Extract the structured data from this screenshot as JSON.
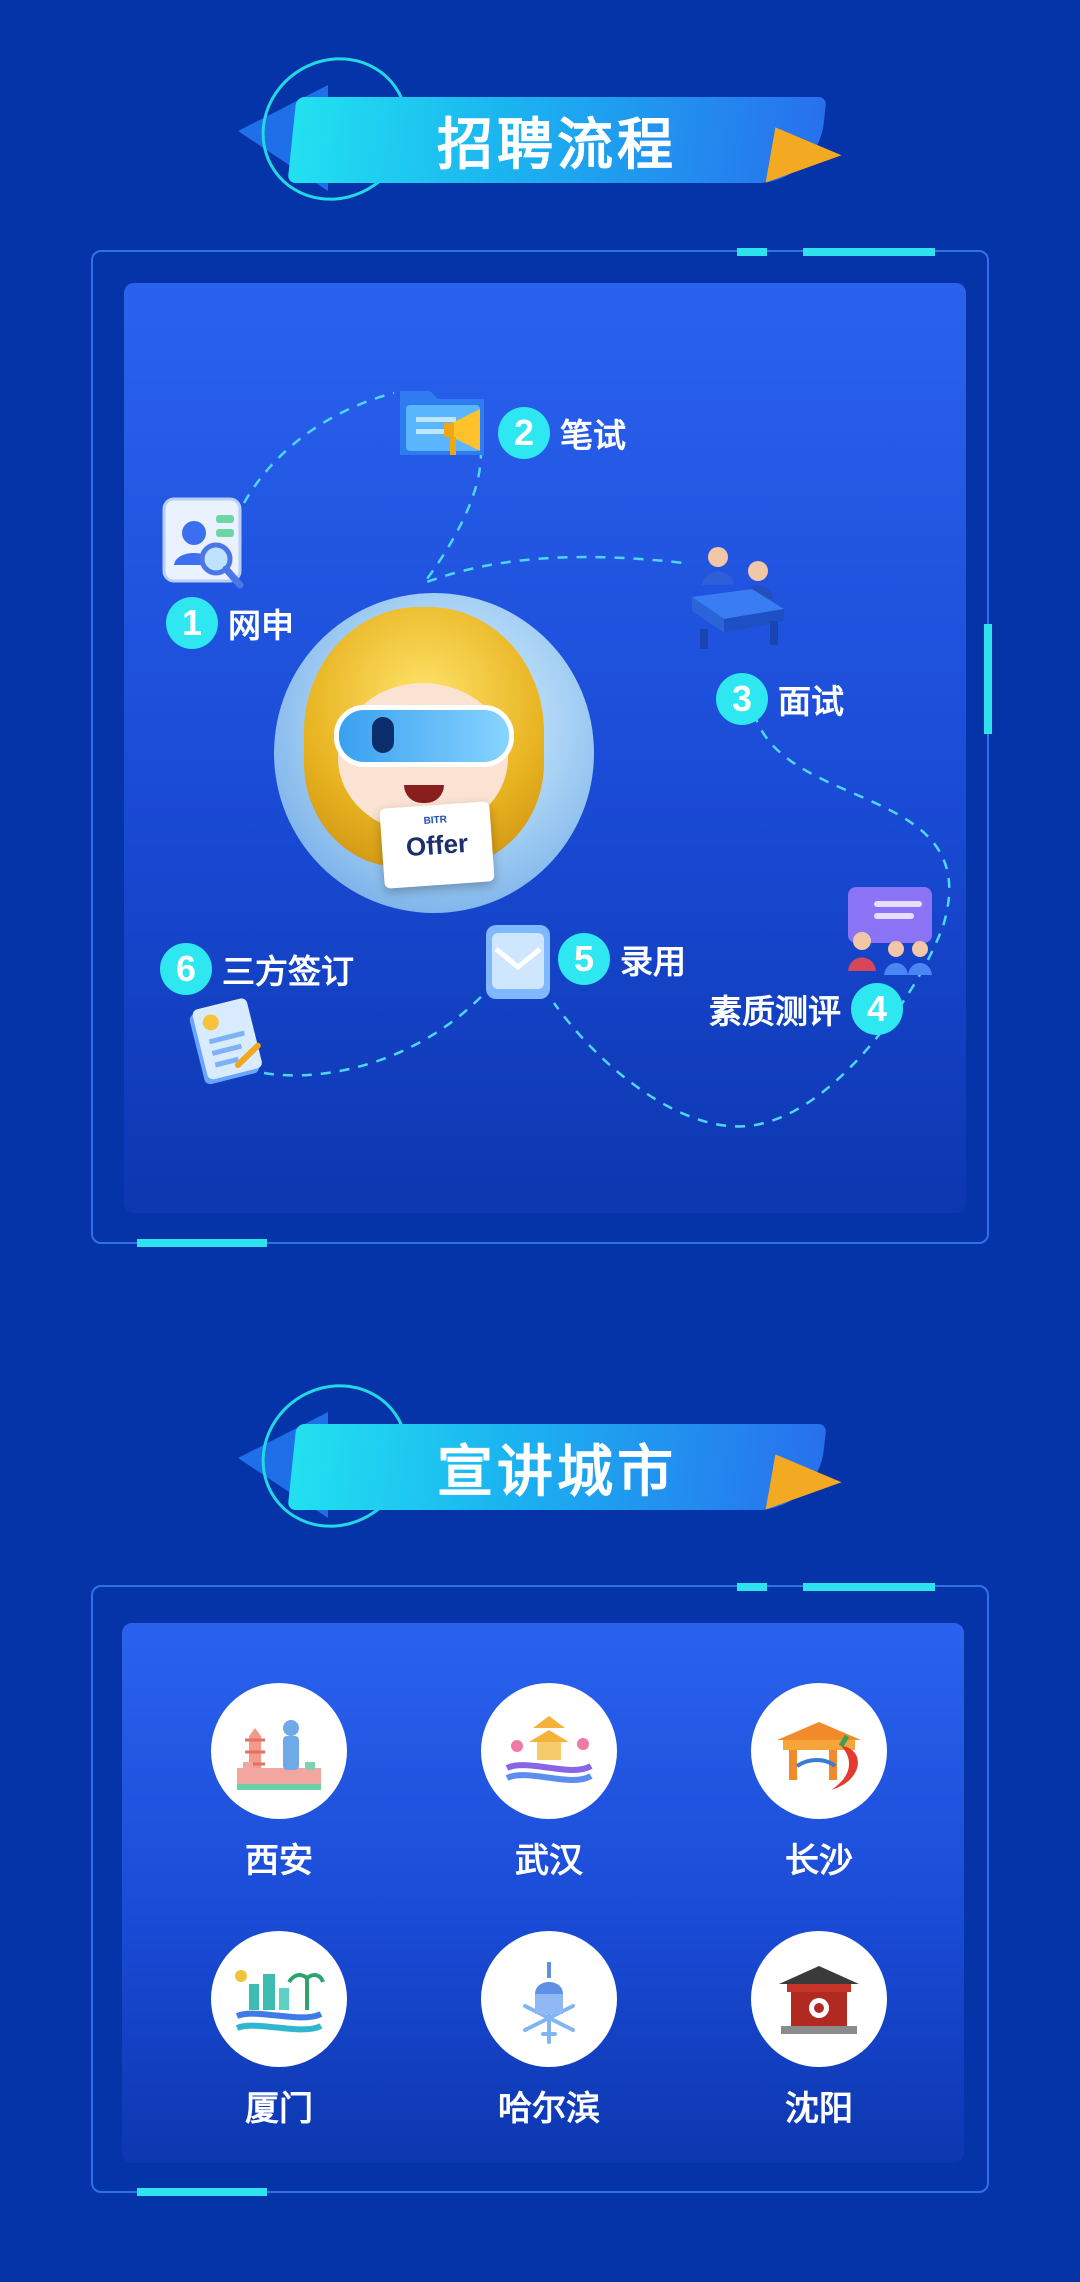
{
  "section_process": {
    "title": "招聘流程",
    "steps": [
      {
        "num": "1",
        "label": "网申",
        "icon": "profile-search-icon"
      },
      {
        "num": "2",
        "label": "笔试",
        "icon": "folder-megaphone-icon"
      },
      {
        "num": "3",
        "label": "面试",
        "icon": "interview-desk-icon"
      },
      {
        "num": "4",
        "label": "素质测评",
        "icon": "assessment-board-icon"
      },
      {
        "num": "5",
        "label": "录用",
        "icon": "envelope-icon"
      },
      {
        "num": "6",
        "label": "三方签订",
        "icon": "contract-document-icon"
      }
    ],
    "mascot_card_text": "Offer",
    "mascot_card_logo": "BITR"
  },
  "section_cities": {
    "title": "宣讲城市",
    "cities": [
      {
        "name": "西安",
        "icon": "xian-landmark-icon"
      },
      {
        "name": "武汉",
        "icon": "wuhan-tower-icon"
      },
      {
        "name": "长沙",
        "icon": "changsha-pepper-icon"
      },
      {
        "name": "厦门",
        "icon": "xiamen-coast-icon"
      },
      {
        "name": "哈尔滨",
        "icon": "harbin-snowflake-icon"
      },
      {
        "name": "沈阳",
        "icon": "shenyang-palace-icon"
      }
    ]
  },
  "colors": {
    "background": "#0533a8",
    "accent_cyan": "#2ee7f0",
    "accent_orange": "#f4a922",
    "panel_blue": "#2a62ee"
  }
}
